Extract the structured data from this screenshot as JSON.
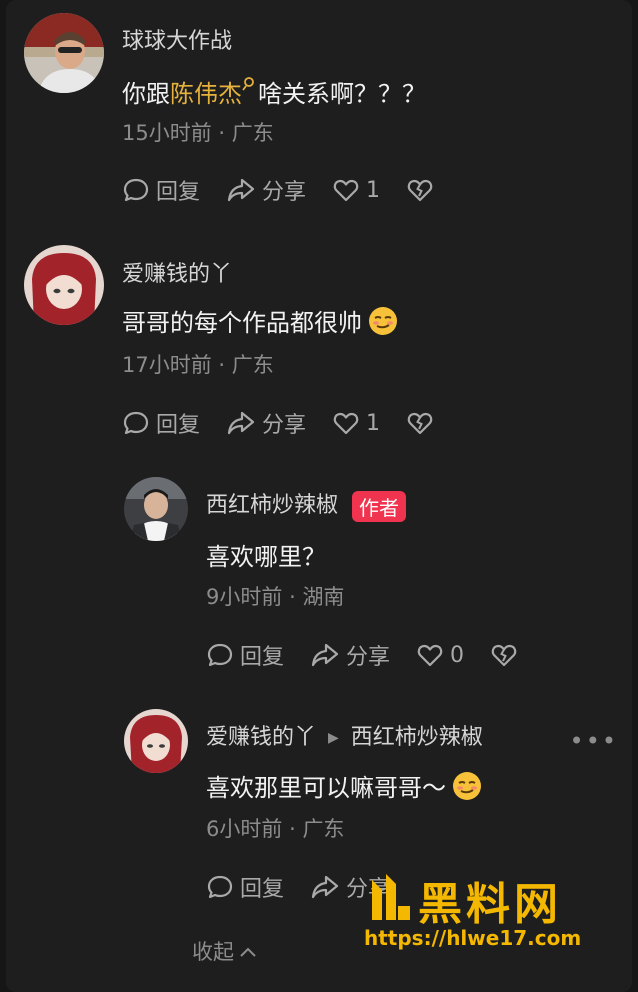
{
  "comments": [
    {
      "username": "球球大作战",
      "text_before": "你跟",
      "mention": "陈伟杰",
      "text_after": "啥关系啊？？？",
      "time": "15小时前",
      "location": "广东",
      "reply_label": "回复",
      "share_label": "分享",
      "likes": "1"
    },
    {
      "username": "爱赚钱的丫",
      "text": "哥哥的每个作品都很帅",
      "time": "17小时前",
      "location": "广东",
      "reply_label": "回复",
      "share_label": "分享",
      "likes": "1"
    }
  ],
  "replies": [
    {
      "username": "西红柿炒辣椒",
      "badge": "作者",
      "text": "喜欢哪里？",
      "time": "9小时前",
      "location": "湖南",
      "reply_label": "回复",
      "share_label": "分享",
      "likes": "0"
    },
    {
      "username": "爱赚钱的丫",
      "reply_to": "西红柿炒辣椒",
      "text": "喜欢那里可以嘛哥哥～",
      "time": "6小时前",
      "location": "广东",
      "reply_label": "回复",
      "share_label": "分享"
    }
  ],
  "meta_separator": "·",
  "collapse_label": "收起",
  "watermark": {
    "title": "黑料网",
    "url": "https://hlwe17.com"
  },
  "colors": {
    "background": "#1e1e1e",
    "mention": "#e6b23c",
    "author_badge": "#f0344f",
    "watermark": "#f5b800"
  }
}
